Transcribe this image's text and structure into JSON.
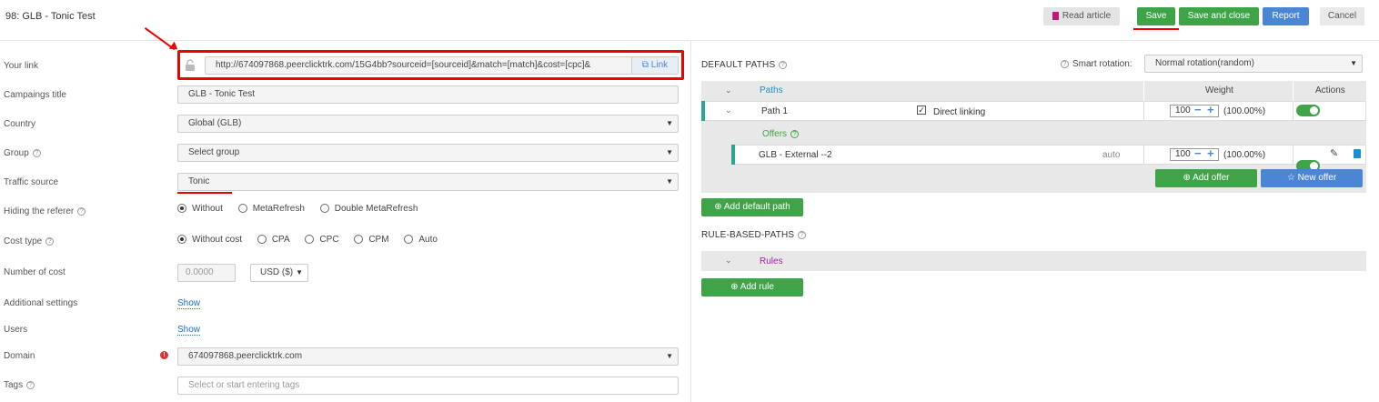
{
  "header": {
    "title": "98: GLB - Tonic Test",
    "read_article": "Read article",
    "save": "Save",
    "save_and_close": "Save and close",
    "report": "Report",
    "cancel": "Cancel"
  },
  "form": {
    "your_link": {
      "label": "Your link",
      "value": "http://674097868.peerclicktrk.com/15G4bb?sourceid=[sourceid]&match=[match]&cost=[cpc]&",
      "link_button": "Link"
    },
    "campaign_title": {
      "label": "Campaings title",
      "value": "GLB - Tonic Test"
    },
    "country": {
      "label": "Country",
      "value": "Global (GLB)"
    },
    "group": {
      "label": "Group",
      "placeholder": "Select group"
    },
    "traffic_source": {
      "label": "Traffic source",
      "value": "Tonic"
    },
    "hiding_referer": {
      "label": "Hiding the referer",
      "options": [
        "Without",
        "MetaRefresh",
        "Double MetaRefresh"
      ],
      "selected": "Without"
    },
    "cost_type": {
      "label": "Cost type",
      "options": [
        "Without cost",
        "CPA",
        "CPC",
        "CPM",
        "Auto"
      ],
      "selected": "Without cost"
    },
    "number_of_cost": {
      "label": "Number of cost",
      "value": "0.0000",
      "currency": "USD ($)"
    },
    "additional_settings": {
      "label": "Additional settings",
      "link": "Show"
    },
    "users": {
      "label": "Users",
      "link": "Show"
    },
    "domain": {
      "label": "Domain",
      "value": "674097868.peerclicktrk.com"
    },
    "tags": {
      "label": "Tags",
      "placeholder": "Select or start entering tags"
    }
  },
  "default_paths": {
    "title": "DEFAULT PATHS",
    "smart_rotation_label": "Smart rotation:",
    "smart_rotation_value": "Normal rotation(random)",
    "columns": {
      "paths": "Paths",
      "weight": "Weight",
      "actions": "Actions"
    },
    "path": {
      "name": "Path 1",
      "direct_linking": "Direct linking",
      "weight": "100",
      "percent": "(100.00%)"
    },
    "offers_label": "Offers",
    "offer": {
      "name": "GLB - External --2",
      "mode": "auto",
      "weight": "100",
      "percent": "(100.00%)"
    },
    "add_offer": "Add offer",
    "new_offer": "New offer",
    "add_default_path": "Add default path"
  },
  "rule_based": {
    "title": "RULE-BASED-PATHS",
    "rules_label": "Rules",
    "add_rule": "Add rule"
  },
  "colors": {
    "green": "#3ea447",
    "blue": "#4a86d4",
    "annotation_red": "#e00000",
    "teal_marker": "#2aa58f",
    "rules_purple": "#a020a0"
  }
}
